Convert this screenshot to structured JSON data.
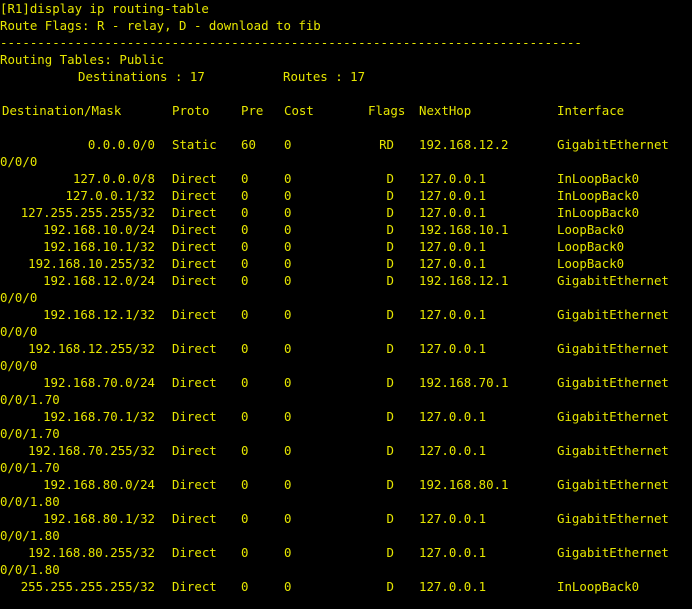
{
  "prompt": "[R1]display ip routing-table",
  "route_flags": "Route Flags: R - relay, D - download to fib",
  "separator": "------------------------------------------------------------------------------",
  "routing_tables": "Routing Tables: Public",
  "destinations_label": "Destinations : 17",
  "routes_label": "Routes : 17",
  "headers": {
    "dest": "Destination/Mask",
    "proto": "Proto",
    "pre": "Pre",
    "cost": "Cost",
    "flags": "Flags",
    "nexthop": "NextHop",
    "iface": "Interface"
  },
  "routes": [
    {
      "dest": "0.0.0.0/0",
      "proto": "Static",
      "pre": "60",
      "cost": "0",
      "flags": "RD",
      "nexthop": "192.168.12.2",
      "iface": "GigabitEthernet",
      "cont": "0/0/0"
    },
    {
      "dest": "127.0.0.0/8",
      "proto": "Direct",
      "pre": "0",
      "cost": "0",
      "flags": "D",
      "nexthop": "127.0.0.1",
      "iface": "InLoopBack0",
      "cont": ""
    },
    {
      "dest": "127.0.0.1/32",
      "proto": "Direct",
      "pre": "0",
      "cost": "0",
      "flags": "D",
      "nexthop": "127.0.0.1",
      "iface": "InLoopBack0",
      "cont": ""
    },
    {
      "dest": "127.255.255.255/32",
      "proto": "Direct",
      "pre": "0",
      "cost": "0",
      "flags": "D",
      "nexthop": "127.0.0.1",
      "iface": "InLoopBack0",
      "cont": ""
    },
    {
      "dest": "192.168.10.0/24",
      "proto": "Direct",
      "pre": "0",
      "cost": "0",
      "flags": "D",
      "nexthop": "192.168.10.1",
      "iface": "LoopBack0",
      "cont": ""
    },
    {
      "dest": "192.168.10.1/32",
      "proto": "Direct",
      "pre": "0",
      "cost": "0",
      "flags": "D",
      "nexthop": "127.0.0.1",
      "iface": "LoopBack0",
      "cont": ""
    },
    {
      "dest": "192.168.10.255/32",
      "proto": "Direct",
      "pre": "0",
      "cost": "0",
      "flags": "D",
      "nexthop": "127.0.0.1",
      "iface": "LoopBack0",
      "cont": ""
    },
    {
      "dest": "192.168.12.0/24",
      "proto": "Direct",
      "pre": "0",
      "cost": "0",
      "flags": "D",
      "nexthop": "192.168.12.1",
      "iface": "GigabitEthernet",
      "cont": "0/0/0"
    },
    {
      "dest": "192.168.12.1/32",
      "proto": "Direct",
      "pre": "0",
      "cost": "0",
      "flags": "D",
      "nexthop": "127.0.0.1",
      "iface": "GigabitEthernet",
      "cont": "0/0/0"
    },
    {
      "dest": "192.168.12.255/32",
      "proto": "Direct",
      "pre": "0",
      "cost": "0",
      "flags": "D",
      "nexthop": "127.0.0.1",
      "iface": "GigabitEthernet",
      "cont": "0/0/0"
    },
    {
      "dest": "192.168.70.0/24",
      "proto": "Direct",
      "pre": "0",
      "cost": "0",
      "flags": "D",
      "nexthop": "192.168.70.1",
      "iface": "GigabitEthernet",
      "cont": "0/0/1.70"
    },
    {
      "dest": "192.168.70.1/32",
      "proto": "Direct",
      "pre": "0",
      "cost": "0",
      "flags": "D",
      "nexthop": "127.0.0.1",
      "iface": "GigabitEthernet",
      "cont": "0/0/1.70"
    },
    {
      "dest": "192.168.70.255/32",
      "proto": "Direct",
      "pre": "0",
      "cost": "0",
      "flags": "D",
      "nexthop": "127.0.0.1",
      "iface": "GigabitEthernet",
      "cont": "0/0/1.70"
    },
    {
      "dest": "192.168.80.0/24",
      "proto": "Direct",
      "pre": "0",
      "cost": "0",
      "flags": "D",
      "nexthop": "192.168.80.1",
      "iface": "GigabitEthernet",
      "cont": "0/0/1.80"
    },
    {
      "dest": "192.168.80.1/32",
      "proto": "Direct",
      "pre": "0",
      "cost": "0",
      "flags": "D",
      "nexthop": "127.0.0.1",
      "iface": "GigabitEthernet",
      "cont": "0/0/1.80"
    },
    {
      "dest": "192.168.80.255/32",
      "proto": "Direct",
      "pre": "0",
      "cost": "0",
      "flags": "D",
      "nexthop": "127.0.0.1",
      "iface": "GigabitEthernet",
      "cont": "0/0/1.80"
    },
    {
      "dest": "255.255.255.255/32",
      "proto": "Direct",
      "pre": "0",
      "cost": "0",
      "flags": "D",
      "nexthop": "127.0.0.1",
      "iface": "InLoopBack0",
      "cont": ""
    }
  ]
}
